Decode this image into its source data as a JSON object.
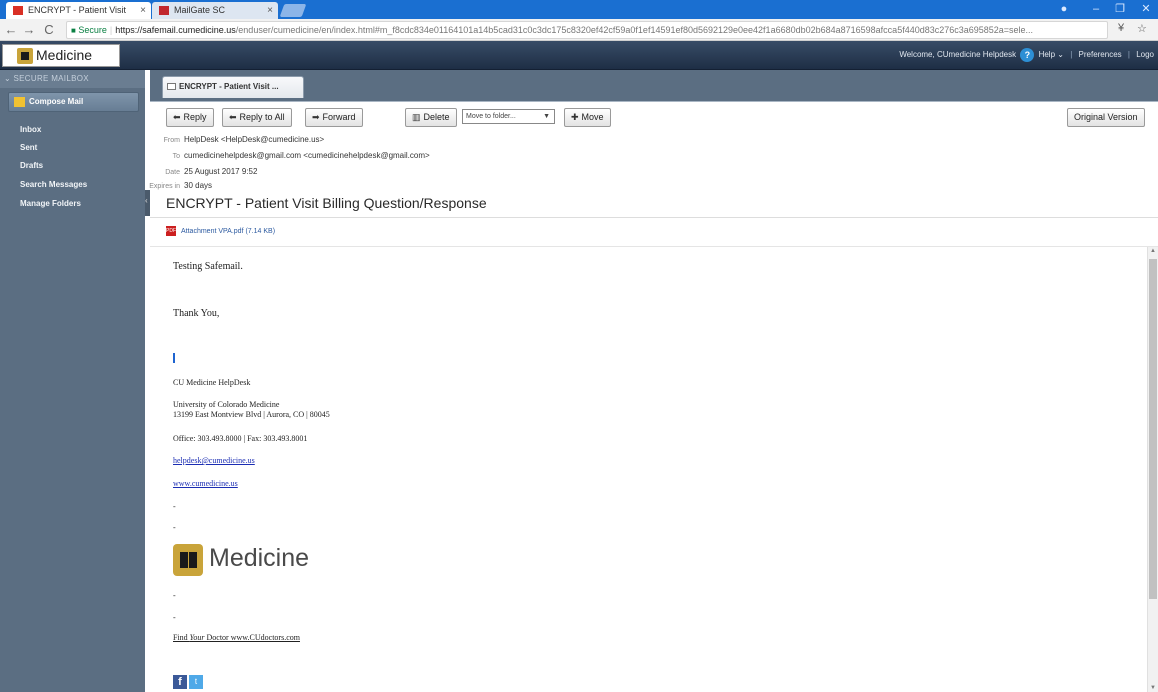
{
  "browser": {
    "tabs": [
      {
        "title": "ENCRYPT - Patient Visit"
      },
      {
        "title": "MailGate SC"
      }
    ],
    "address": {
      "secure_label": "Secure",
      "host": "https://safemail.cumedicine.us",
      "path": "/enduser/cumedicine/en/index.html#m_f8cdc834e01164101a14b5cad31c0c3dc175c8320ef42cf59a0f1ef14591ef80d5692129e0ee42f1a6680db02b684a8716598afcca5f440d83c276c3a695852a=sele..."
    }
  },
  "app": {
    "logo_text": "Medicine",
    "welcome": "Welcome, CUmedicine Helpdesk",
    "help_label": "Help",
    "preferences_label": "Preferences",
    "logout_label": "Logo"
  },
  "sidebar": {
    "mailbox_header": "Secure Mailbox",
    "compose_label": "Compose Mail",
    "items": [
      {
        "label": "Inbox"
      },
      {
        "label": "Sent"
      },
      {
        "label": "Drafts"
      },
      {
        "label": "Search Messages"
      },
      {
        "label": "Manage Folders"
      }
    ]
  },
  "message_tab": {
    "label": "ENCRYPT - Patient Visit ..."
  },
  "toolbar": {
    "reply_label": "Reply",
    "reply_all_label": "Reply to All",
    "forward_label": "Forward",
    "delete_label": "Delete",
    "folder_select_value": "Move to folder...",
    "move_label": "Move",
    "original_version_label": "Original Version"
  },
  "headers": {
    "from_label": "From",
    "from_value": "HelpDesk <HelpDesk@cumedicine.us>",
    "to_label": "To",
    "to_value": "cumedicinehelpdesk@gmail.com <cumedicinehelpdesk@gmail.com>",
    "date_label": "Date",
    "date_value": "25 August 2017 9:52",
    "expires_label": "Expires in",
    "expires_value": "30 days"
  },
  "subject": "ENCRYPT - Patient Visit Billing Question/Response",
  "attachment": "Attachment VPA.pdf (7.14 KB)",
  "body": {
    "greeting": "Testing Safemail.",
    "thanks": "Thank You,",
    "sig_name": "CU Medicine HelpDesk",
    "sig_org": "University of Colorado Medicine",
    "sig_address": "13199 East Montview Blvd | Aurora, CO | 80045",
    "sig_phone": "Office: 303.493.8000 | Fax: 303.493.8001",
    "sig_email": "helpdesk@cumedicine.us",
    "sig_web": "www.cumedicine.us",
    "dash1": "-",
    "dash2": "-",
    "dash3": "-",
    "dash4": "-",
    "logo_text": "Medicine",
    "find_doctor_prefix": "Find ",
    "find_doctor_your": "Your",
    "find_doctor_suffix": " Doctor www.CUdoctors.com"
  }
}
